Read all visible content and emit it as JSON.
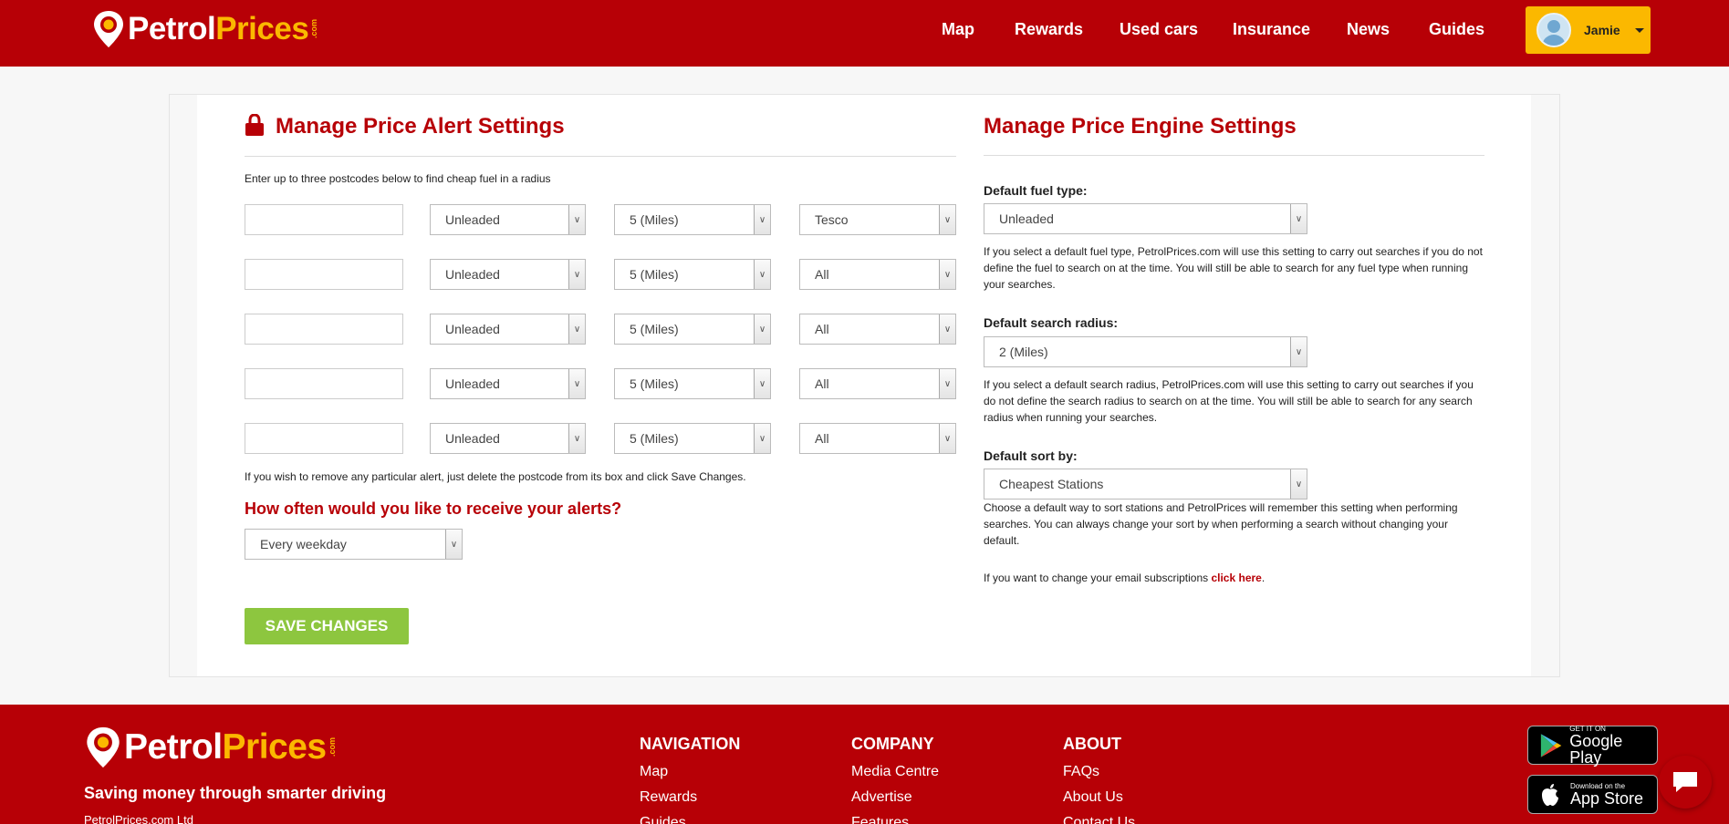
{
  "header": {
    "logo_primary": "Petrol",
    "logo_secondary": "Prices",
    "logo_suffix": ".com",
    "nav": [
      "Map",
      "Rewards",
      "Used cars",
      "Insurance",
      "News",
      "Guides"
    ],
    "user_name": "Jamie"
  },
  "alerts": {
    "title": "Manage Price Alert Settings",
    "intro": "Enter up to three postcodes below to find cheap fuel in a radius",
    "rows": [
      {
        "postcode": "",
        "fuel": "Unleaded",
        "radius": "5 (Miles)",
        "brand": "Tesco"
      },
      {
        "postcode": "",
        "fuel": "Unleaded",
        "radius": "5 (Miles)",
        "brand": "All"
      },
      {
        "postcode": "",
        "fuel": "Unleaded",
        "radius": "5 (Miles)",
        "brand": "All"
      },
      {
        "postcode": "",
        "fuel": "Unleaded",
        "radius": "5 (Miles)",
        "brand": "All"
      },
      {
        "postcode": "",
        "fuel": "Unleaded",
        "radius": "5 (Miles)",
        "brand": "All"
      }
    ],
    "remove_note": "If you wish to remove any particular alert, just delete the postcode from its box and click Save Changes.",
    "frequency_question": "How often would you like to receive your alerts?",
    "frequency_value": "Every weekday",
    "save_label": "SAVE CHANGES"
  },
  "engine": {
    "title": "Manage Price Engine Settings",
    "fuel_label": "Default fuel type:",
    "fuel_value": "Unleaded",
    "fuel_help": "If you select a default fuel type, PetrolPrices.com will use this setting to carry out searches if you do not define the fuel to search on at the time. You will still be able to search for any fuel type when running your searches.",
    "radius_label": "Default search radius:",
    "radius_value": "2 (Miles)",
    "radius_help": "If you select a default search radius, PetrolPrices.com will use this setting to carry out searches if you do not define the search radius to search on at the time. You will still be able to search for any search radius when running your searches.",
    "sort_label": "Default sort by:",
    "sort_value": "Cheapest Stations",
    "sort_help": "Choose a default way to sort stations and PetrolPrices will remember this setting when performing searches. You can always change your sort by when performing a search without changing your default.",
    "email_text": "If you want to change your email subscriptions ",
    "email_link": "click here",
    "email_end": "."
  },
  "footer": {
    "tagline": "Saving money through smarter driving",
    "company": "PetrolPrices.com Ltd",
    "navigation": {
      "heading": "NAVIGATION",
      "items": [
        "Map",
        "Rewards",
        "Guides"
      ]
    },
    "company_col": {
      "heading": "COMPANY",
      "items": [
        "Media Centre",
        "Advertise",
        "Features"
      ]
    },
    "about": {
      "heading": "ABOUT",
      "items": [
        "FAQs",
        "About Us",
        "Contact Us"
      ]
    },
    "google_play": {
      "line1": "GET IT ON",
      "line2": "Google Play"
    },
    "app_store": {
      "line1": "Download on the",
      "line2": "App Store"
    }
  },
  "colors": {
    "brand_red": "#b70006",
    "brand_yellow": "#fbb800",
    "save_green": "#8dc63f"
  }
}
